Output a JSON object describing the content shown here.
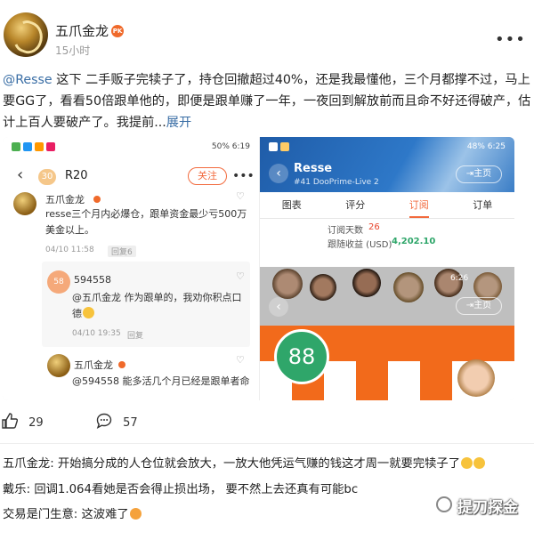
{
  "post": {
    "author": "五爪金龙",
    "author_badge": "PK",
    "time": "15小时",
    "more": "•••",
    "mention": "@Resse",
    "text": " 这下 二手贩子完犊子了，持仓回撤超过40%，还是我最懂他，三个月都撑不过，马上要GG了，看看50倍跟单他的，即便是跟单赚了一年，一夜回到解放前而且命不好还得破产，估计上百人要破产了。我提前...",
    "expand": "展开"
  },
  "left_phone": {
    "status_time": "6:19",
    "status_battery": "50%",
    "level": "30",
    "title": "R20",
    "follow": "关注",
    "more": "•••",
    "comments": [
      {
        "name": "五爪金龙",
        "text_line1": "resse三个月内必爆仓，跟单资金最少亏500万",
        "text_line2": "美金以上。",
        "date": "04/10 11:58",
        "reply_count": "回复6"
      },
      {
        "avatar_num": "58",
        "name": "594558",
        "text_line1": "@五爪金龙 作为跟单的，我劝你积点口",
        "text_line2": "德",
        "date": "04/10 19:35",
        "reply": "回复"
      },
      {
        "name": "五爪金龙",
        "text_line1": "@594558 能多活几个月已经是跟单者命"
      }
    ]
  },
  "right_phone": {
    "status_time": "6:25",
    "status_battery": "48%",
    "title": "Resse",
    "subtitle": "#41  DooPrime-Live 2",
    "home": "主页",
    "tabs": [
      "图表",
      "评分",
      "订阅",
      "订单"
    ],
    "active_tab": 2,
    "stats": [
      {
        "label": "订阅天数",
        "value": "26",
        "color": "#e8452c"
      },
      {
        "label": "跟随收益 (USD)",
        "value": "4,202.10",
        "color": "#2fa66a"
      }
    ],
    "overlay_time": "6:26",
    "overlay_home": "主页",
    "score": "88"
  },
  "actions": {
    "likes": "29",
    "comments": "57"
  },
  "comments": [
    {
      "who": "五爪金龙",
      "text": "开始搞分成的人仓位就会放大，一放大他凭运气赚的钱这才周一就要完犊子了"
    },
    {
      "who": "戴乐",
      "text": "回调1.064看她是否会得止损出场， 要不然上去还真有可能bc"
    },
    {
      "who": "交易是门生意",
      "text": "这波难了"
    }
  ],
  "watermark": "提刀探金",
  "colors": {
    "accent": "#f26a3d",
    "link": "#3a6ea5",
    "header_blue": "#1f5ca8",
    "score_green": "#2fa66a",
    "mosaic_orange": "#f26a1b"
  }
}
